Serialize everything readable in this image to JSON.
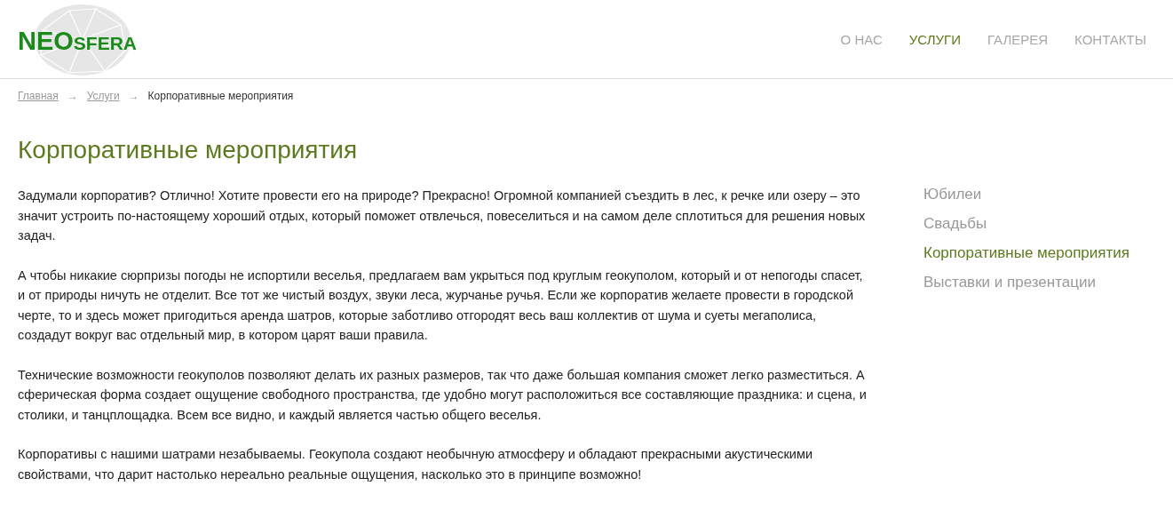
{
  "logo": {
    "main": "NEO",
    "sub": "SFERA"
  },
  "nav": [
    {
      "label": "О НАС",
      "selected": false
    },
    {
      "label": "УСЛУГИ",
      "selected": true
    },
    {
      "label": "ГАЛЕРЕЯ",
      "selected": false
    },
    {
      "label": "КОНТАКТЫ",
      "selected": false
    }
  ],
  "breadcrumbs": {
    "links": [
      "Главная",
      "Услуги"
    ],
    "separator": "→",
    "current": "Корпоративные мероприятия"
  },
  "title": "Корпоративные мероприятия",
  "paragraphs": [
    "Задумали корпоратив? Отлично! Хотите провести его на природе? Прекрасно! Огромной компанией съездить в лес, к речке или озеру – это значит устроить по-настоящему хороший отдых, который поможет отвлечься, повеселиться и на самом деле сплотиться для решения новых задач.",
    "А чтобы никакие сюрпризы погоды не испортили веселья, предлагаем вам укрыться под круглым геокуполом, который и от непогоды спасет, и от природы ничуть не отделит. Все тот же чистый воздух, звуки леса, журчанье ручья. Если же корпоратив желаете провести в городской черте, то и здесь может пригодиться аренда шатров, которые заботливо отгородят весь ваш коллектив от шума и суеты мегаполиса, создадут вокруг вас отдельный мир, в котором царят ваши правила.",
    "Технические возможности геокуполов позволяют делать их разных размеров, так что даже большая компания сможет легко разместиться. А сферическая форма создает ощущение свободного пространства, где удобно могут расположиться все составляющие праздника: и сцена, и столики, и танцплощадка. Всем все видно, и каждый является частью общего веселья.",
    "Корпоративы с нашими шатрами незабываемы. Геокупола создают необычную атмосферу и обладают прекрасными акустическими свойствами, что дарит настолько нереально реальные ощущения, насколько это в принципе возможно!"
  ],
  "sidebar": [
    {
      "label": "Юбилеи",
      "selected": false
    },
    {
      "label": "Свадьбы",
      "selected": false
    },
    {
      "label": "Корпоративные мероприятия",
      "selected": true
    },
    {
      "label": "Выставки и презентации",
      "selected": false
    }
  ]
}
